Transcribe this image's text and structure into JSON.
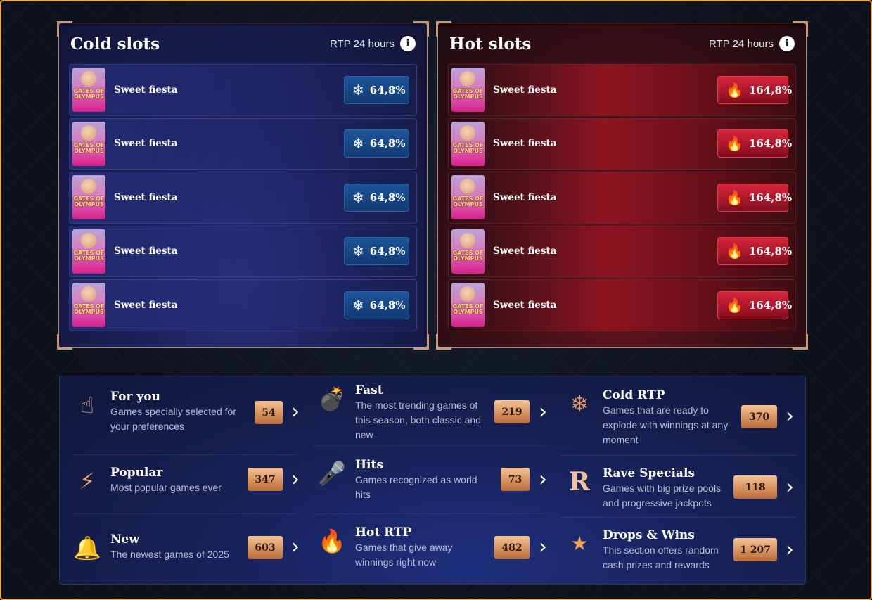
{
  "cold_panel": {
    "title": "Cold slots",
    "rtp_label": "RTP 24 hours",
    "info_icon": "i",
    "badge_icon": "snowflake-icon",
    "rows": [
      {
        "game_art": "GATES OF OLYMPUS",
        "name": "Sweet fiesta",
        "rtp": "64,8%"
      },
      {
        "game_art": "GATES OF OLYMPUS",
        "name": "Sweet fiesta",
        "rtp": "64,8%"
      },
      {
        "game_art": "GATES OF OLYMPUS",
        "name": "Sweet fiesta",
        "rtp": "64,8%"
      },
      {
        "game_art": "GATES OF OLYMPUS",
        "name": "Sweet fiesta",
        "rtp": "64,8%"
      },
      {
        "game_art": "GATES OF OLYMPUS",
        "name": "Sweet fiesta",
        "rtp": "64,8%"
      }
    ]
  },
  "hot_panel": {
    "title": "Hot slots",
    "rtp_label": "RTP 24 hours",
    "info_icon": "i",
    "badge_icon": "flame-icon",
    "rows": [
      {
        "game_art": "GATES OF OLYMPUS",
        "name": "Sweet fiesta",
        "rtp": "164,8%"
      },
      {
        "game_art": "GATES OF OLYMPUS",
        "name": "Sweet fiesta",
        "rtp": "164,8%"
      },
      {
        "game_art": "GATES OF OLYMPUS",
        "name": "Sweet fiesta",
        "rtp": "164,8%"
      },
      {
        "game_art": "GATES OF OLYMPUS",
        "name": "Sweet fiesta",
        "rtp": "164,8%"
      },
      {
        "game_art": "GATES OF OLYMPUS",
        "name": "Sweet fiesta",
        "rtp": "164,8%"
      }
    ]
  },
  "categories": [
    {
      "title": "For you",
      "desc": "Games specially selected for your preferences",
      "count": "54",
      "icon": "pointing-finger-icon"
    },
    {
      "title": "Fast",
      "desc": "The most trending games of this season, both classic and new",
      "count": "219",
      "icon": "bomb-icon"
    },
    {
      "title": "Cold RTP",
      "desc": "Games that are ready to explode with winnings at any moment",
      "count": "370",
      "icon": "snowflake-icon"
    },
    {
      "title": "Popular",
      "desc": "Most popular games ever",
      "count": "347",
      "icon": "lightning-icon"
    },
    {
      "title": "Hits",
      "desc": "Games recognized as world hits",
      "count": "73",
      "icon": "microphone-icon"
    },
    {
      "title": "Rave Specials",
      "desc": "Games with big prize pools and progressive jackpots",
      "count": "118",
      "icon": "rave-r-logo-icon"
    },
    {
      "title": "New",
      "desc": "The newest games of 2025",
      "count": "603",
      "icon": "bell-icon"
    },
    {
      "title": "Hot RTP",
      "desc": "Games that give away winnings right now",
      "count": "482",
      "icon": "flame-icon"
    },
    {
      "title": "Drops & Wins",
      "desc": "This section offers random cash prizes and rewards",
      "count": "1 207",
      "icon": "drops-wins-logo-icon"
    }
  ],
  "colors": {
    "frame_border": "#f0a93a",
    "cold_badge": "#1d5599",
    "hot_badge": "#d6253b",
    "count_badge": "#d8925f"
  }
}
